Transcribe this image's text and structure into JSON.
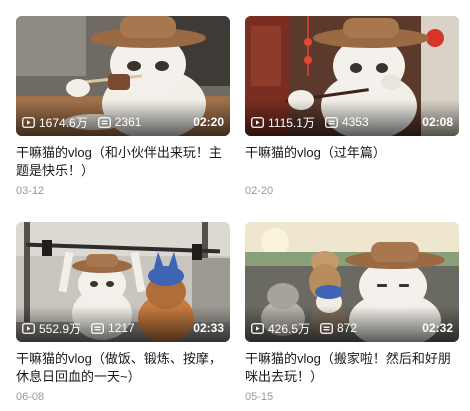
{
  "videos": [
    {
      "views": "1674.6万",
      "comments": "2361",
      "duration": "02:20",
      "title": "干嘛猫的vlog（和小伙伴出来玩！主题是快乐！）",
      "date": "03-12"
    },
    {
      "views": "1115.1万",
      "comments": "4353",
      "duration": "02:08",
      "title": "干嘛猫的vlog（过年篇）",
      "date": "02-20"
    },
    {
      "views": "552.9万",
      "comments": "1217",
      "duration": "02:33",
      "title": "干嘛猫的vlog（做饭、锻炼、按摩，休息日回血的一天~）",
      "date": "06-08"
    },
    {
      "views": "426.5万",
      "comments": "872",
      "duration": "02:32",
      "title": "干嘛猫的vlog（搬家啦！然后和好朋咪出去玩！）",
      "date": "05-15"
    }
  ],
  "icons": {
    "views": "play-count-icon",
    "comments": "danmaku-count-icon"
  },
  "colors": {
    "title": "#18191c",
    "date": "#9499a0",
    "overlay_text": "#ffffff"
  }
}
